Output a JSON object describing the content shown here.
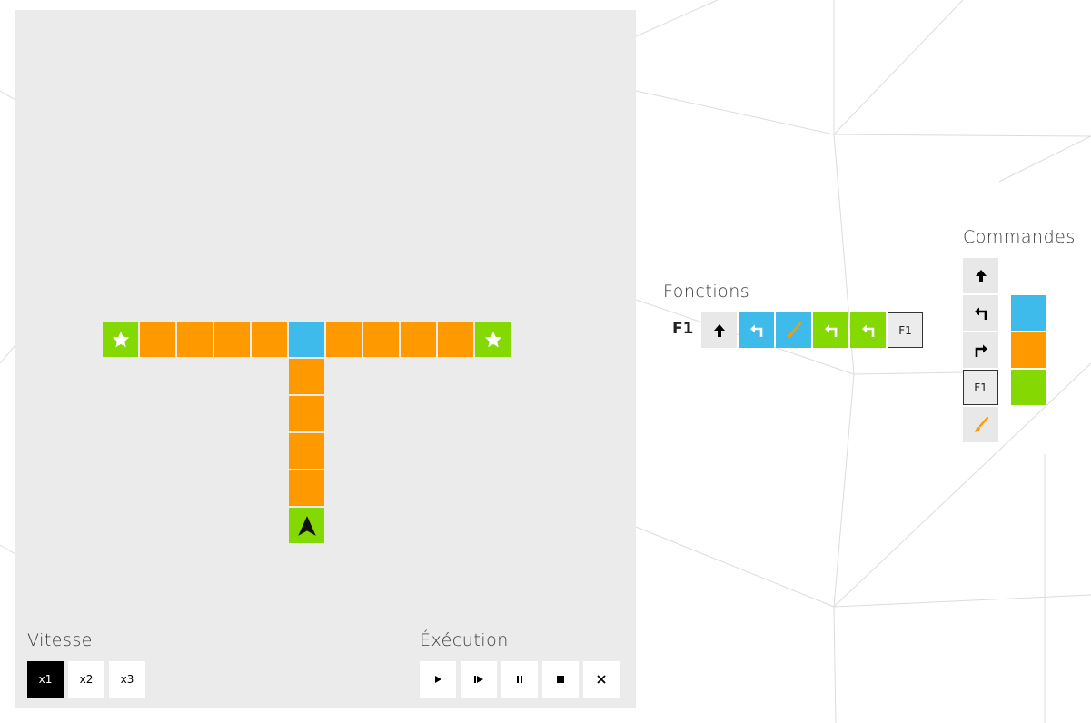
{
  "colors": {
    "orange": "#ff9900",
    "blue": "#3ebbea",
    "green": "#84d903",
    "board_bg": "#ebebeb",
    "command_bg": "#e8e8e8"
  },
  "board": {
    "tiles": [
      {
        "row": 0,
        "col": 0,
        "color": "green",
        "content": "star-icon"
      },
      {
        "row": 0,
        "col": 1,
        "color": "orange"
      },
      {
        "row": 0,
        "col": 2,
        "color": "orange"
      },
      {
        "row": 0,
        "col": 3,
        "color": "orange"
      },
      {
        "row": 0,
        "col": 4,
        "color": "orange"
      },
      {
        "row": 0,
        "col": 5,
        "color": "blue"
      },
      {
        "row": 0,
        "col": 6,
        "color": "orange"
      },
      {
        "row": 0,
        "col": 7,
        "color": "orange"
      },
      {
        "row": 0,
        "col": 8,
        "color": "orange"
      },
      {
        "row": 0,
        "col": 9,
        "color": "orange"
      },
      {
        "row": 0,
        "col": 10,
        "color": "green",
        "content": "star-icon"
      },
      {
        "row": 1,
        "col": 5,
        "color": "orange"
      },
      {
        "row": 2,
        "col": 5,
        "color": "orange"
      },
      {
        "row": 3,
        "col": 5,
        "color": "orange"
      },
      {
        "row": 4,
        "col": 5,
        "color": "orange"
      },
      {
        "row": 5,
        "col": 5,
        "color": "green",
        "content": "robot-arrow-icon"
      }
    ]
  },
  "speed": {
    "label": "Vitesse",
    "buttons": [
      {
        "label": "x1",
        "active": true
      },
      {
        "label": "x2",
        "active": false
      },
      {
        "label": "x3",
        "active": false
      }
    ]
  },
  "execution": {
    "label": "Éxécution",
    "buttons": [
      {
        "name": "play-button",
        "icon": "play-icon"
      },
      {
        "name": "step-button",
        "icon": "step-icon"
      },
      {
        "name": "pause-button",
        "icon": "pause-icon"
      },
      {
        "name": "stop-button",
        "icon": "stop-icon"
      },
      {
        "name": "clear-button",
        "icon": "close-icon"
      }
    ]
  },
  "functions": {
    "label": "Fonctions",
    "f1": {
      "name": "F1",
      "slots": [
        {
          "icon": "arrow-up-icon",
          "color": null
        },
        {
          "icon": "turn-left-icon",
          "color": "blue"
        },
        {
          "icon": "paint-brush-icon",
          "color": "blue"
        },
        {
          "icon": "turn-left-icon",
          "color": "green"
        },
        {
          "icon": "turn-left-icon",
          "color": "green"
        },
        {
          "icon": "F1",
          "color": null
        }
      ]
    }
  },
  "commands": {
    "label": "Commandes",
    "items": [
      {
        "icon": "arrow-up-icon",
        "label": ""
      },
      {
        "icon": "turn-left-icon",
        "label": ""
      },
      {
        "icon": "turn-right-icon",
        "label": ""
      },
      {
        "icon": "function-icon",
        "label": "F1"
      },
      {
        "icon": "paint-brush-icon",
        "label": ""
      }
    ],
    "colors": [
      "blue",
      "orange",
      "green"
    ]
  }
}
